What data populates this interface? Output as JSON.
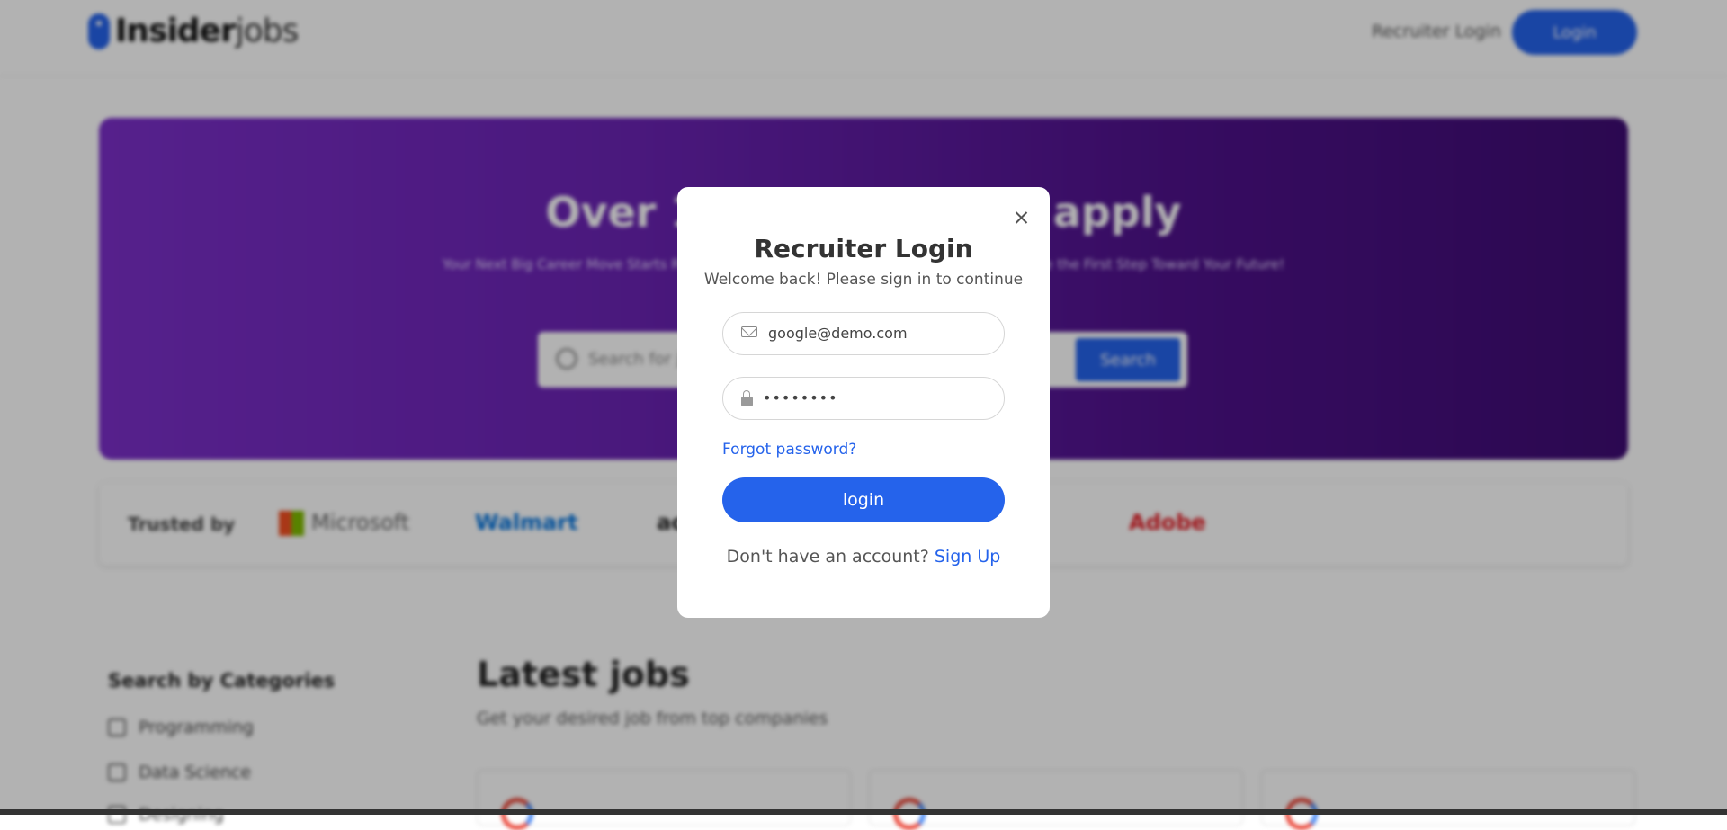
{
  "navbar": {
    "logo_bold": "Insider",
    "logo_thin": "jobs",
    "recruiter_link": "Recruiter Login",
    "login_button": "Login"
  },
  "hero": {
    "title": "Over 10,000+ jobs to apply",
    "subtitle": "Your Next Big Career Move Starts Right Here - Explore the Best Job Opportunities and Take the First Step Toward Your Future!",
    "search_placeholder": "Search for jobs",
    "search_button": "Search"
  },
  "trusted": {
    "label": "Trusted by",
    "brands": [
      "Microsoft",
      "Walmart",
      "accenture",
      "Adobe"
    ]
  },
  "categories": {
    "title": "Search by Categories",
    "items": [
      "Programming",
      "Data Science",
      "Designing"
    ]
  },
  "jobs": {
    "title": "Latest jobs",
    "subtitle": "Get your desired job from top companies"
  },
  "modal": {
    "title": "Recruiter Login",
    "subtitle": "Welcome back! Please sign in to continue",
    "email_value": "google@demo.com",
    "password_value": "••••••••",
    "forgot_link": "Forgot password?",
    "login_button": "login",
    "signup_prompt": "Don't have an account?",
    "signup_link": "Sign Up"
  },
  "colors": {
    "accent": "#2563eb",
    "hero_start": "#7b2fc9",
    "hero_end": "#3e0c73"
  },
  "icons": {
    "close": "close-icon",
    "email": "mail-icon",
    "password": "lock-icon"
  }
}
